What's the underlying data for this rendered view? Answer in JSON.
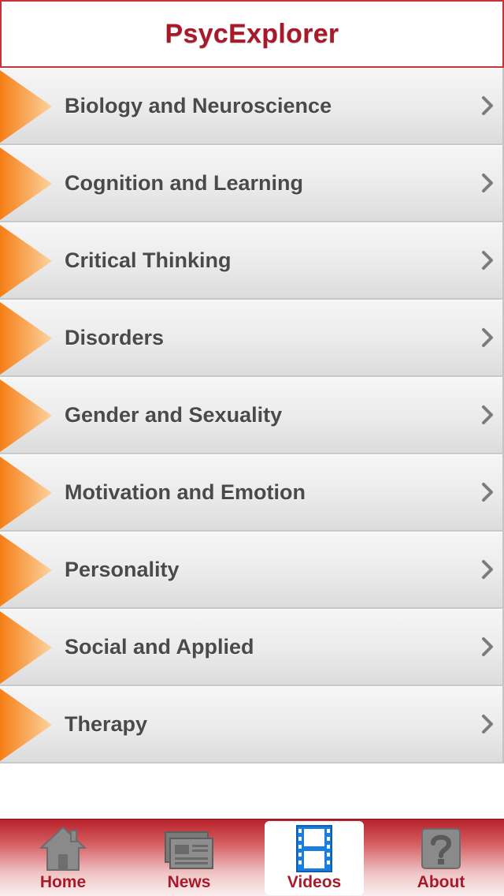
{
  "header": {
    "title": "PsycExplorer"
  },
  "categories": [
    {
      "label": "Biology and Neuroscience"
    },
    {
      "label": "Cognition and Learning"
    },
    {
      "label": "Critical Thinking"
    },
    {
      "label": "Disorders"
    },
    {
      "label": "Gender and Sexuality"
    },
    {
      "label": "Motivation and Emotion"
    },
    {
      "label": "Personality"
    },
    {
      "label": "Social and Applied"
    },
    {
      "label": "Therapy"
    }
  ],
  "row_icons": {
    "leading": "orange-triangle-icon",
    "trailing": "chevron-right-icon"
  },
  "tabs": [
    {
      "label": "Home",
      "icon": "house-icon",
      "active": false
    },
    {
      "label": "News",
      "icon": "newspaper-icon",
      "active": false
    },
    {
      "label": "Videos",
      "icon": "film-strip-icon",
      "active": true
    },
    {
      "label": "About",
      "icon": "question-mark-icon",
      "active": false
    }
  ],
  "colors": {
    "brand_red": "#a8192a",
    "accent_orange": "#f7932a",
    "active_icon_blue": "#1a7ee0",
    "row_text": "#4a4a4a"
  }
}
